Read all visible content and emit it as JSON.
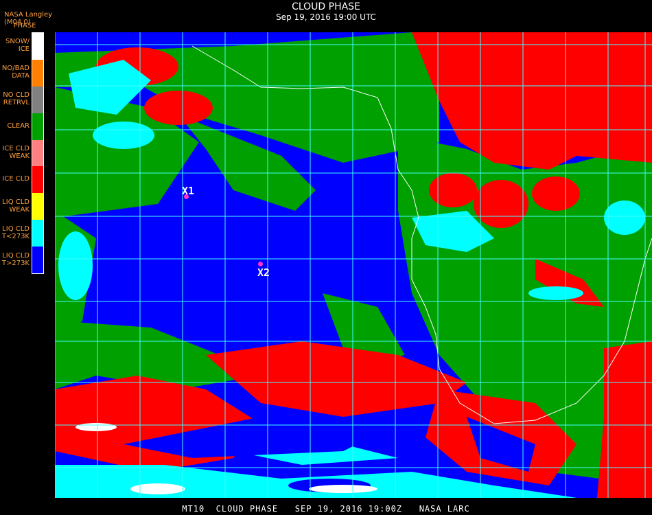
{
  "header": {
    "title": "CLOUD PHASE",
    "subtitle": "Sep 19, 2016 19:00 UTC",
    "producer": "NASA Langley (M04.0)",
    "legend_title": "PHASE"
  },
  "legend": [
    {
      "label": "SNOW/\nICE",
      "color": "#ffffff"
    },
    {
      "label": "NO/BAD\nDATA",
      "color": "#ff8000"
    },
    {
      "label": "NO CLD\nRETRVL",
      "color": "#808080"
    },
    {
      "label": "CLEAR",
      "color": "#00a000"
    },
    {
      "label": "ICE CLD\nWEAK",
      "color": "#ff8080"
    },
    {
      "label": "ICE CLD",
      "color": "#ff0000"
    },
    {
      "label": "LIQ CLD\nWEAK",
      "color": "#ffff00"
    },
    {
      "label": "LIQ CLD\nT<273K",
      "color": "#00ffff"
    },
    {
      "label": "LIQ CLD\nT>273K",
      "color": "#0000ff"
    }
  ],
  "markers": [
    {
      "label": "X1"
    },
    {
      "label": "X2"
    }
  ],
  "footer": "MT10  CLOUD PHASE   SEP 19, 2016 19:00Z   NASA LARC",
  "colors": {
    "grid": "#40ffff",
    "coast": "#ffffff",
    "marker": "#ff33cc",
    "latlabel": "#b04020"
  }
}
